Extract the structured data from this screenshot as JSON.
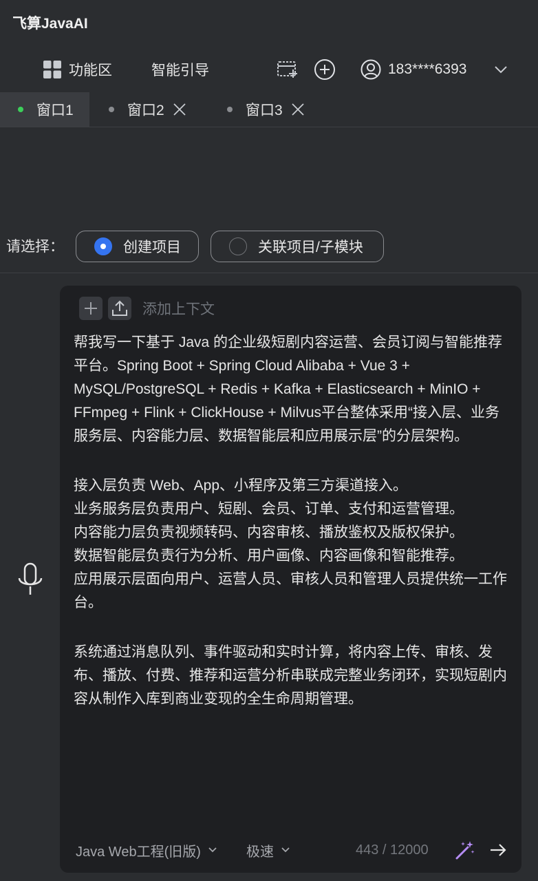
{
  "app": {
    "title": "飞算JavaAI"
  },
  "toolbar": {
    "features_label": "功能区",
    "guide_label": "智能引导",
    "user_phone": "183****6393"
  },
  "tabs": [
    {
      "label": "窗口1",
      "active": true
    },
    {
      "label": "窗口2",
      "active": false
    },
    {
      "label": "窗口3",
      "active": false
    }
  ],
  "select": {
    "label": "请选择：",
    "options": [
      {
        "label": "创建项目",
        "selected": true
      },
      {
        "label": "关联项目/子模块",
        "selected": false
      }
    ]
  },
  "context": {
    "add_label": "添加上下文"
  },
  "prompt": {
    "paragraph_1": "帮我写一下基于 Java 的企业级短剧内容运营、会员订阅与智能推荐平台。Spring Boot + Spring Cloud Alibaba + Vue 3 + MySQL/PostgreSQL + Redis + Kafka + Elasticsearch + MinIO + FFmpeg + Flink + ClickHouse + Milvus平台整体采用“接入层、业务服务层、内容能力层、数据智能层和应用展示层”的分层架构。",
    "line_access": "接入层负责 Web、App、小程序及第三方渠道接入。",
    "line_business": "业务服务层负责用户、短剧、会员、订单、支付和运营管理。",
    "line_content": "内容能力层负责视频转码、内容审核、播放鉴权及版权保护。",
    "line_data": "数据智能层负责行为分析、用户画像、内容画像和智能推荐。",
    "line_app": "应用展示层面向用户、运营人员、审核人员和管理人员提供统一工作台。",
    "paragraph_last": "系统通过消息队列、事件驱动和实时计算，将内容上传、审核、发布、播放、付费、推荐和运营分析串联成完整业务闭环，实现短剧内容从制作入库到商业变现的全生命周期管理。"
  },
  "footer": {
    "project_type": "Java Web工程(旧版)",
    "speed_mode": "极速",
    "char_count": "443 / 12000"
  },
  "colors": {
    "background": "#2b2d30",
    "panel": "#1e1f22",
    "accent": "#3574f0",
    "active_dot": "#3ccf5a",
    "wand": "#b58cf5"
  },
  "icons": {
    "features": "grid-icon",
    "new_window": "new-window-icon",
    "add": "plus-circle-icon",
    "user": "user-icon",
    "chevron": "chevron-down-icon",
    "close": "close-icon",
    "mic": "microphone-icon",
    "upload": "upload-icon",
    "wand": "magic-wand-icon",
    "send": "arrow-right-icon"
  }
}
